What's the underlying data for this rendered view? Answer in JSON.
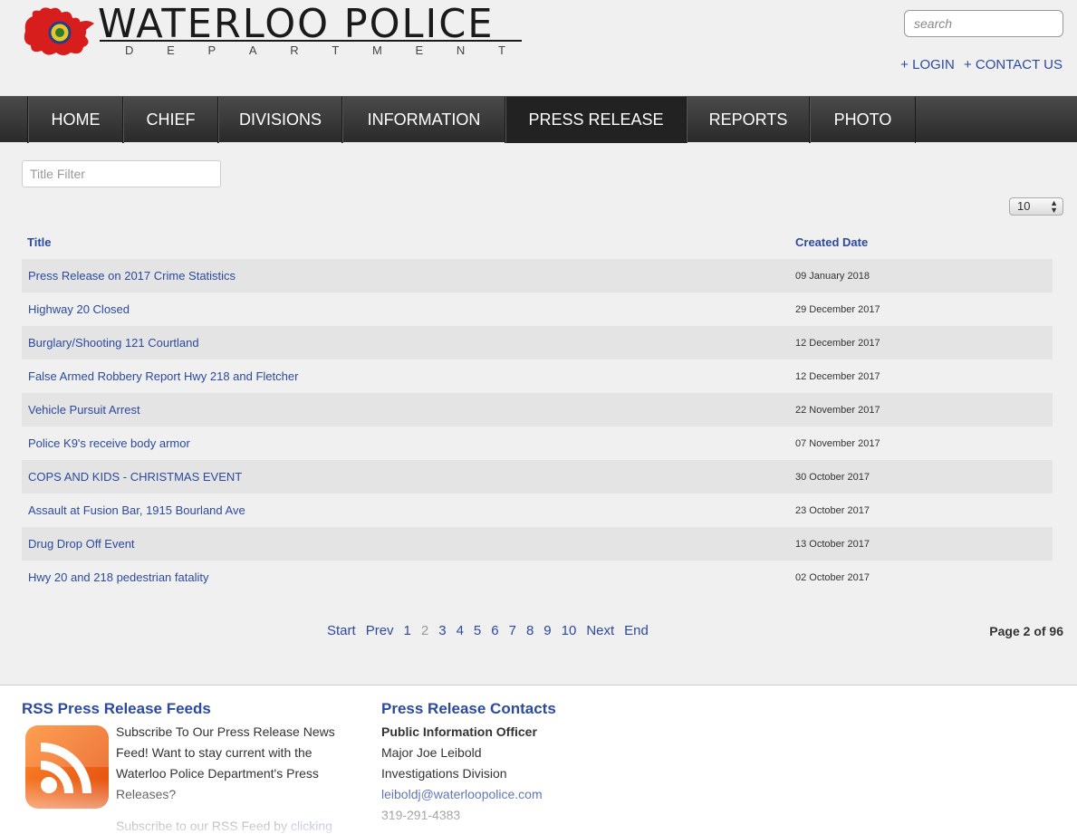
{
  "header": {
    "logo_word": "WATERLOO POLICE",
    "logo_sub": [
      "D",
      "E",
      "P",
      "A",
      "R",
      "T",
      "M",
      "E",
      "N",
      "T"
    ],
    "search_placeholder": "search",
    "login_link": "+ LOGIN",
    "contact_link": "+ CONTACT US"
  },
  "nav": {
    "items": [
      {
        "label": "HOME",
        "active": false
      },
      {
        "label": "CHIEF",
        "active": false
      },
      {
        "label": "DIVISIONS",
        "active": false
      },
      {
        "label": "INFORMATION",
        "active": false
      },
      {
        "label": "PRESS RELEASE",
        "active": true
      },
      {
        "label": "REPORTS",
        "active": false
      },
      {
        "label": "PHOTO",
        "active": false
      }
    ]
  },
  "filter": {
    "placeholder": "Title Filter"
  },
  "per_page": {
    "value": "10"
  },
  "table": {
    "col_title": "Title",
    "col_date": "Created Date",
    "rows": [
      {
        "title": "Press Release on 2017 Crime Statistics",
        "date": "09 January 2018"
      },
      {
        "title": "Highway 20 Closed",
        "date": "29 December 2017"
      },
      {
        "title": "Burglary/Shooting 121 Courtland",
        "date": "12 December 2017"
      },
      {
        "title": "False Armed Robbery Report Hwy 218 and Fletcher",
        "date": "12 December 2017"
      },
      {
        "title": "Vehicle Pursuit Arrest",
        "date": "22 November 2017"
      },
      {
        "title": "Police K9's receive body armor",
        "date": "07 November 2017"
      },
      {
        "title": "COPS AND KIDS - CHRISTMAS EVENT",
        "date": "30 October 2017"
      },
      {
        "title": "Assault at Fusion Bar, 1915 Bourland Ave",
        "date": "23 October 2017"
      },
      {
        "title": "Drug Drop Off Event",
        "date": "13 October 2017"
      },
      {
        "title": "Hwy 20 and 218 pedestrian fatality",
        "date": "02 October 2017"
      }
    ]
  },
  "pagination": {
    "start": "Start",
    "prev": "Prev",
    "pages": [
      "1",
      "2",
      "3",
      "4",
      "5",
      "6",
      "7",
      "8",
      "9",
      "10"
    ],
    "current": "2",
    "next": "Next",
    "end": "End",
    "page_info": "Page 2 of 96"
  },
  "footer": {
    "rss_heading": "RSS Press Release Feeds",
    "rss_text": "Subscribe To Our Press Release News Feed! Want to stay current with the Waterloo Police Department's Press Releases?",
    "rss_text2": "Subscribe to our RSS Feed by",
    "rss_link": "clicking",
    "contacts_heading": "Press Release Contacts",
    "contact_role": "Public Information Officer",
    "contact_name": "Major Joe Leibold",
    "contact_division": "Investigations Division",
    "contact_email": "leiboldj@waterloopolice.com",
    "contact_phone": "319-291-4383"
  }
}
